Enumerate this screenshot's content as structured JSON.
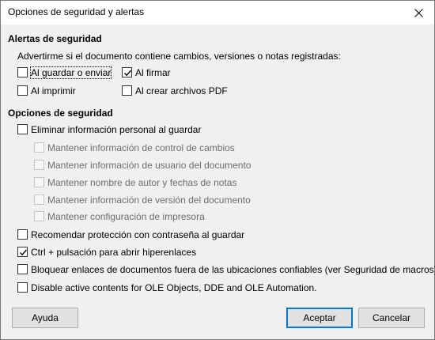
{
  "window": {
    "title": "Opciones de seguridad y alertas",
    "close_icon": "close-icon"
  },
  "alerts": {
    "heading": "Alertas de seguridad",
    "description": "Advertirme si el documento contiene cambios, versiones o notas registradas:",
    "options": [
      {
        "label": "Al guardar o enviar",
        "checked": false
      },
      {
        "label": "Al firmar",
        "checked": true
      },
      {
        "label": "Al imprimir",
        "checked": false
      },
      {
        "label": "Al crear archivos PDF",
        "checked": false
      }
    ]
  },
  "security": {
    "heading": "Opciones de seguridad",
    "remove_personal": {
      "label": "Eliminar información personal al guardar",
      "checked": false
    },
    "sub_options": [
      {
        "label": "Mantener información de control de cambios",
        "checked": false
      },
      {
        "label": "Mantener información de usuario del documento",
        "checked": false
      },
      {
        "label": "Mantener nombre de autor y fechas de notas",
        "checked": false
      },
      {
        "label": "Mantener información de versión del documento",
        "checked": false
      },
      {
        "label": "Mantener configuración de impresora",
        "checked": false
      }
    ],
    "options": [
      {
        "label": "Recomendar protección con contraseña al guardar",
        "checked": false
      },
      {
        "label": "Ctrl + pulsación para abrir hiperenlaces",
        "checked": true
      },
      {
        "label": "Bloquear enlaces de documentos fuera de las ubicaciones confiables (ver Seguridad de macros)",
        "checked": false
      },
      {
        "label": "Disable active contents for OLE Objects, DDE and OLE Automation.",
        "checked": false
      }
    ]
  },
  "buttons": {
    "help": "Ayuda",
    "ok": "Aceptar",
    "cancel": "Cancelar"
  }
}
